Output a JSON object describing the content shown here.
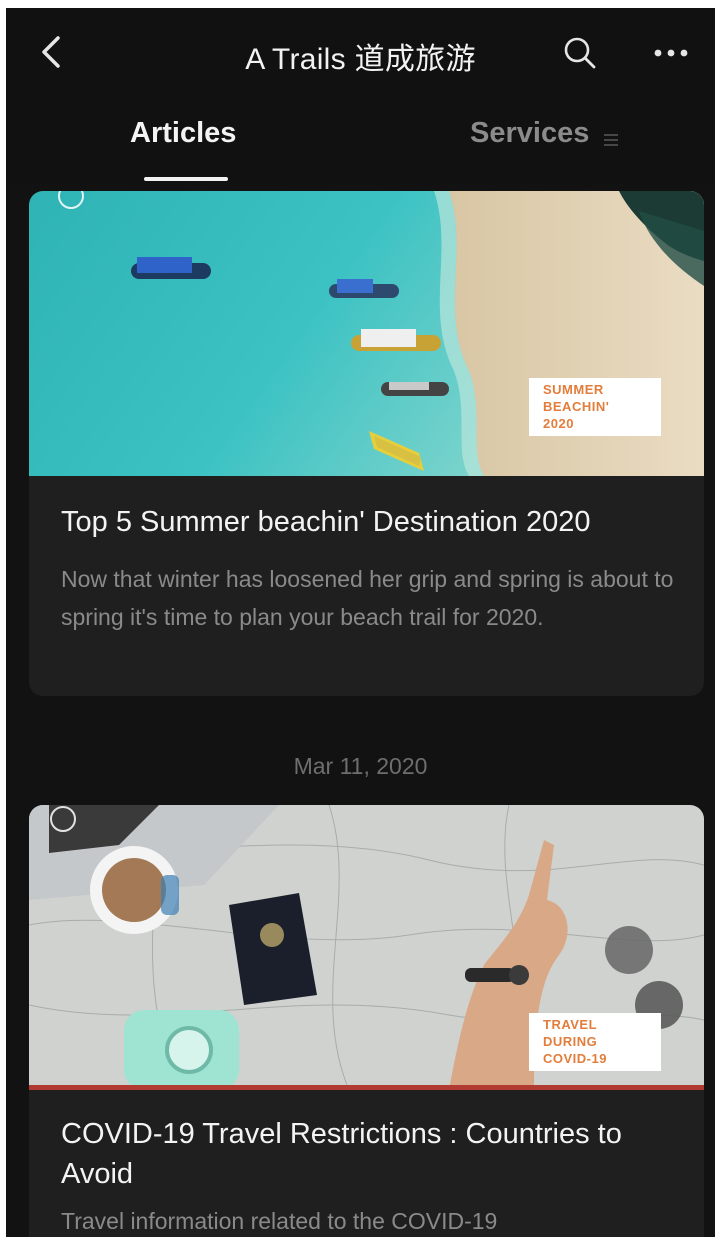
{
  "header": {
    "title": "A Trails 道成旅游",
    "back_icon": "chevron-left-icon",
    "search_icon": "search-icon",
    "more_icon": "more-horizontal-icon"
  },
  "tabs": [
    {
      "label": "Articles",
      "active": true
    },
    {
      "label": "Services",
      "active": false,
      "icon": "menu-lines-icon"
    }
  ],
  "feed": {
    "articles": [
      {
        "badge": [
          "SUMMER",
          "BEACHIN'",
          "2020"
        ],
        "title": "Top 5 Summer beachin' Destination 2020",
        "description": "Now that winter has loosened her grip and spring is about to spring it's time to plan your beach trail for 2020."
      },
      {
        "date": "Mar 11, 2020",
        "badge": [
          "TRAVEL",
          "DURING",
          "COVID-19"
        ],
        "title": "COVID-19 Travel Restrictions : Countries to Avoid",
        "description": "Travel information related to the COVID-19"
      }
    ]
  },
  "colors": {
    "background": "#111111",
    "card": "#1f1f1f",
    "badge_text": "#e27d3b",
    "text_primary": "#f3f3f3",
    "text_secondary": "#8a8a8a"
  }
}
